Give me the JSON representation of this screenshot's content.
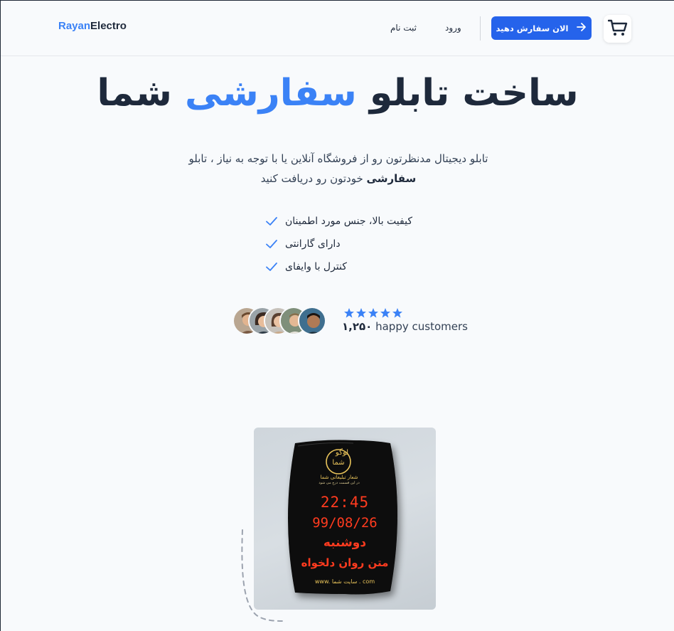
{
  "header": {
    "brand": {
      "part1": "Rayan",
      "part2": "Electro"
    },
    "nav": {
      "register": "ثبت نام",
      "login": "ورود"
    },
    "cta": {
      "label": "الان سفارش دهید",
      "icon": "arrow-right-icon"
    },
    "cart_icon": "cart-icon"
  },
  "hero": {
    "title_part1": "ساخت تابلو",
    "title_accent": "سفارشی",
    "title_part2": "شما",
    "subtitle_line1": "تابلو دیجیتال مدنظرتون رو از فروشگاه آنلاین یا با توجه به نیاز ، تابلو",
    "subtitle_bold": "سفارشی",
    "subtitle_line2_rest": "خودتون رو دریافت کنید",
    "features": [
      "کیفیت بالا، جنس مورد اطمینان",
      "دارای گارانتی",
      "کنترل با وایفای"
    ]
  },
  "social_proof": {
    "rating_stars": 5,
    "customers_count": "۱,۲۵۰",
    "customers_label": "happy customers"
  },
  "product_panel": {
    "logo_line1": "لوگو",
    "logo_line2": "شما",
    "slogan": "شعار تبلیغاتی شما",
    "slogan_sub": "در این قسمت درج می شود",
    "time": "22:45",
    "date": "99/08/26",
    "day": "دوشنبه",
    "scroll_text": "متن روان دلخواه",
    "website": "www. سایت شما . com"
  },
  "colors": {
    "accent": "#3b82f6",
    "cta_bg": "#2563eb",
    "text_dark": "#1e293b",
    "led_red": "#ff3b1f",
    "panel_gold": "#e8c35a"
  }
}
